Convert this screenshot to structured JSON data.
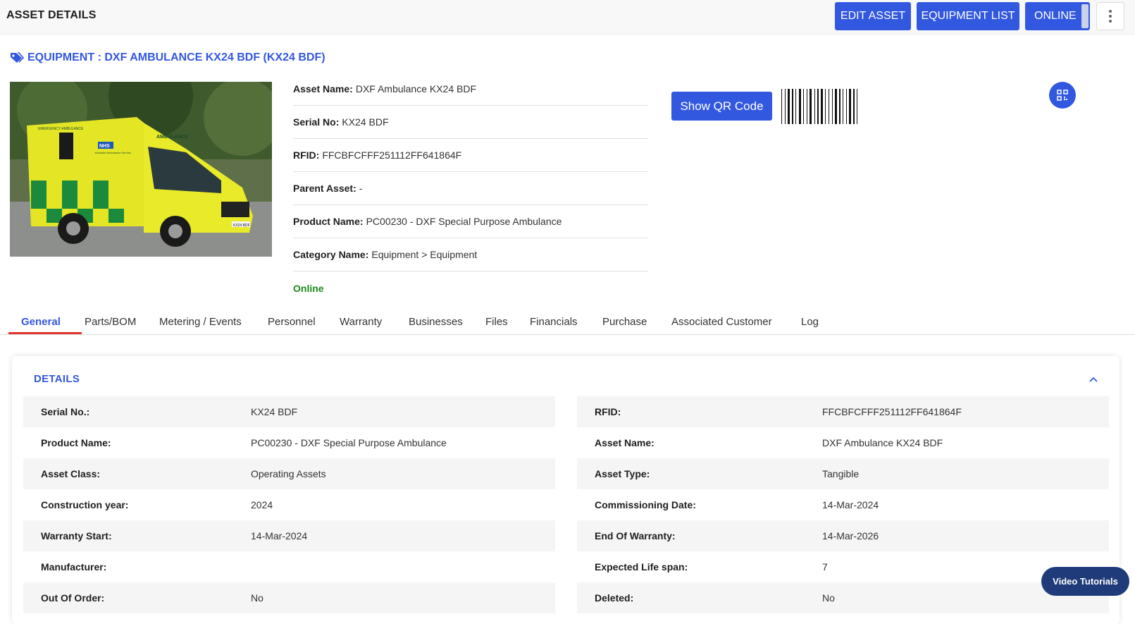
{
  "header": {
    "title": "ASSET DETAILS",
    "edit_label": "EDIT ASSET",
    "list_label": "EQUIPMENT LIST",
    "status_label": "ONLINE"
  },
  "equipment": {
    "heading": "EQUIPMENT : DXF AMBULANCE KX24 BDF (KX24 BDF)",
    "info": [
      {
        "label": "Asset Name:",
        "value": "DXF Ambulance KX24 BDF"
      },
      {
        "label": "Serial No:",
        "value": "KX24 BDF"
      },
      {
        "label": "RFID:",
        "value": "FFCBFCFFF251112FF641864F"
      },
      {
        "label": "Parent Asset:",
        "value": "-"
      },
      {
        "label": "Product Name:",
        "value": "PC00230 - DXF Special Purpose Ambulance"
      },
      {
        "label": "Category Name:",
        "value": "Equipment > Equipment"
      }
    ],
    "status": "Online",
    "qr_button_label": "Show QR Code",
    "photo_texts": {
      "side": "EMERGENCY AMBULANCE",
      "hood": "AMBULANCE",
      "brand": "NHS",
      "service": "Yorkshire Ambulance Service",
      "plate": "KX24 BDF"
    }
  },
  "tabs": [
    "General",
    "Parts/BOM",
    "Metering / Events",
    "Personnel",
    "Warranty",
    "Businesses",
    "Files",
    "Financials",
    "Purchase",
    "Associated Customer",
    "Log"
  ],
  "details": {
    "title": "DETAILS",
    "left": [
      {
        "label": "Serial No.:",
        "value": "KX24 BDF"
      },
      {
        "label": "Product Name:",
        "value": "PC00230 - DXF Special Purpose Ambulance"
      },
      {
        "label": "Asset Class:",
        "value": "Operating Assets"
      },
      {
        "label": "Construction year:",
        "value": "2024"
      },
      {
        "label": "Warranty Start:",
        "value": "14-Mar-2024"
      },
      {
        "label": "Manufacturer:",
        "value": ""
      },
      {
        "label": "Out Of Order:",
        "value": "No"
      }
    ],
    "right": [
      {
        "label": "RFID:",
        "value": "FFCBFCFFF251112FF641864F"
      },
      {
        "label": "Asset Name:",
        "value": "DXF Ambulance KX24 BDF"
      },
      {
        "label": "Asset Type:",
        "value": "Tangible"
      },
      {
        "label": "Commissioning Date:",
        "value": "14-Mar-2024"
      },
      {
        "label": "End Of Warranty:",
        "value": "14-Mar-2026"
      },
      {
        "label": "Expected Life span:",
        "value": "7"
      },
      {
        "label": "Deleted:",
        "value": "No"
      }
    ]
  },
  "video_tutorials_label": "Video Tutorials",
  "colors": {
    "accent": "#3358e0",
    "online_green": "#1d8a1d",
    "tab_underline": "#e0332b",
    "video_button": "#1f3b79"
  }
}
